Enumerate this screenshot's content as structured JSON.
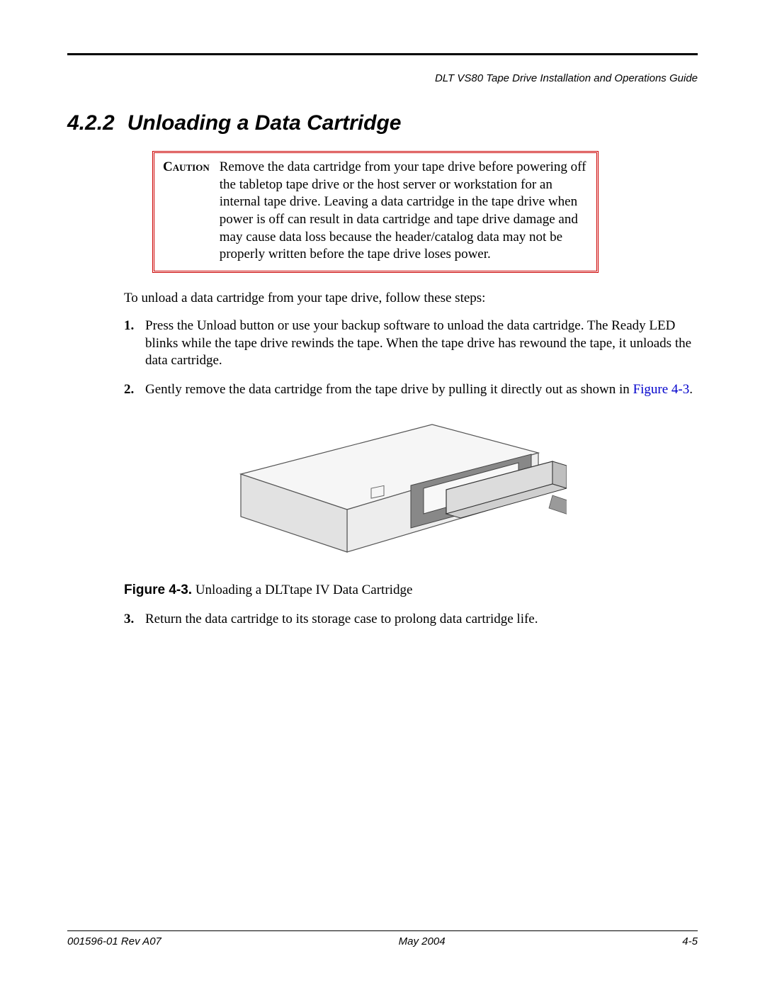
{
  "header": {
    "doc_title": "DLT VS80 Tape Drive Installation and Operations Guide"
  },
  "section": {
    "number": "4.2.2",
    "title": "Unloading a Data Cartridge"
  },
  "caution": {
    "label": "Caution",
    "text": "Remove the data cartridge from your tape drive before powering off the tabletop tape drive or the host server or workstation for an internal tape drive. Leaving a data cartridge in the tape drive when power is off can result in data cartridge and tape drive damage and may cause data loss because the header/catalog data may not be properly written before the tape drive loses power."
  },
  "intro": "To unload a data cartridge from your tape drive, follow these steps:",
  "steps": {
    "n1": "1.",
    "t1": "Press the Unload button or use your backup software to unload the data cartridge. The Ready LED blinks while the tape drive rewinds the tape. When the tape drive has rewound the tape, it unloads the data cartridge.",
    "n2": "2.",
    "t2a": "Gently remove the data cartridge from the tape drive by pulling it directly out as shown in ",
    "t2ref": "Figure 4-3",
    "t2b": ".",
    "n3": "3.",
    "t3": "Return the data cartridge to its storage case to prolong data cartridge life."
  },
  "figure": {
    "label": "Figure 4-3.",
    "caption": "Unloading a DLTtape IV Data Cartridge"
  },
  "footer": {
    "left": "001596-01 Rev A07",
    "center": "May 2004",
    "right": "4-5"
  }
}
